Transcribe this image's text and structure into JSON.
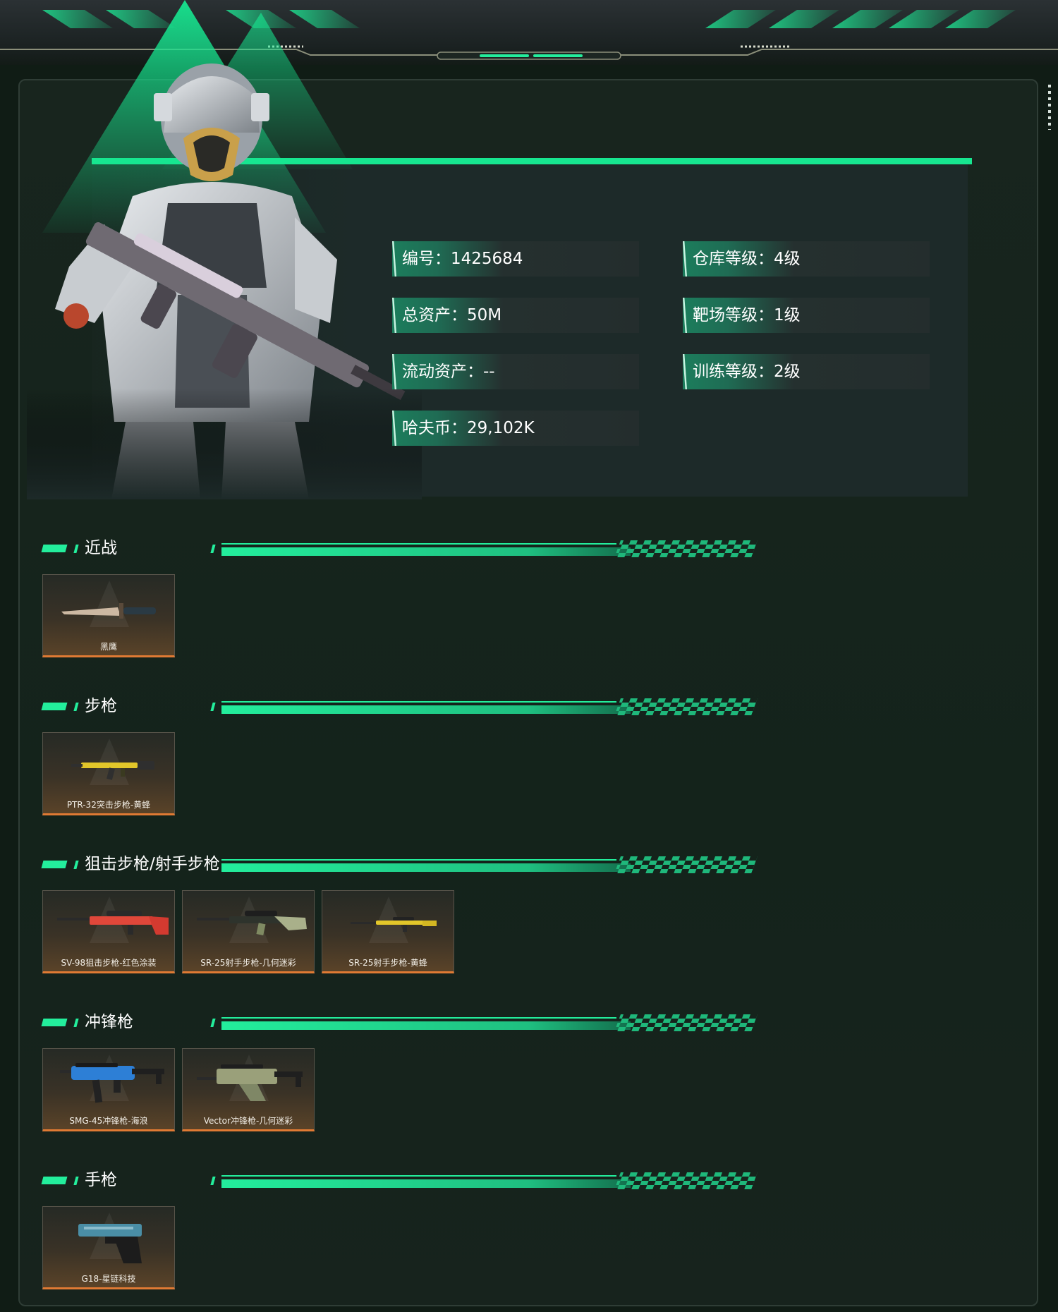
{
  "profile": {
    "stats": [
      {
        "label": "编号：",
        "value": "1425684"
      },
      {
        "label": "总资产：",
        "value": "50M"
      },
      {
        "label": "流动资产：",
        "value": "--"
      },
      {
        "label": "哈夫币：",
        "value": "29,102K"
      },
      {
        "label": "仓库等级：",
        "value": "4级"
      },
      {
        "label": "靶场等级：",
        "value": "1级"
      },
      {
        "label": "训练等级：",
        "value": "2级"
      }
    ]
  },
  "sections": [
    {
      "title": "近战",
      "items": [
        {
          "name": "黑鹰",
          "icon": "knife-icon"
        }
      ]
    },
    {
      "title": "步枪",
      "items": [
        {
          "name": "PTR-32突击步枪-黄蜂",
          "icon": "rifle-icon"
        }
      ]
    },
    {
      "title": "狙击步枪/射手步枪",
      "items": [
        {
          "name": "SV-98狙击步枪-红色涂装",
          "icon": "sniper-rifle-icon"
        },
        {
          "name": "SR-25射手步枪-几何迷彩",
          "icon": "marksman-rifle-icon"
        },
        {
          "name": "SR-25射手步枪-黄蜂",
          "icon": "marksman-rifle-icon"
        }
      ]
    },
    {
      "title": "冲锋枪",
      "items": [
        {
          "name": "SMG-45冲锋枪-海浪",
          "icon": "smg-icon"
        },
        {
          "name": "Vector冲锋枪-几何迷彩",
          "icon": "smg-icon"
        }
      ]
    },
    {
      "title": "手枪",
      "items": [
        {
          "name": "G18-星链科技",
          "icon": "pistol-icon"
        }
      ]
    }
  ],
  "colors": {
    "accent": "#17e690",
    "card_border": "#e07a34",
    "background": "#14231b"
  }
}
